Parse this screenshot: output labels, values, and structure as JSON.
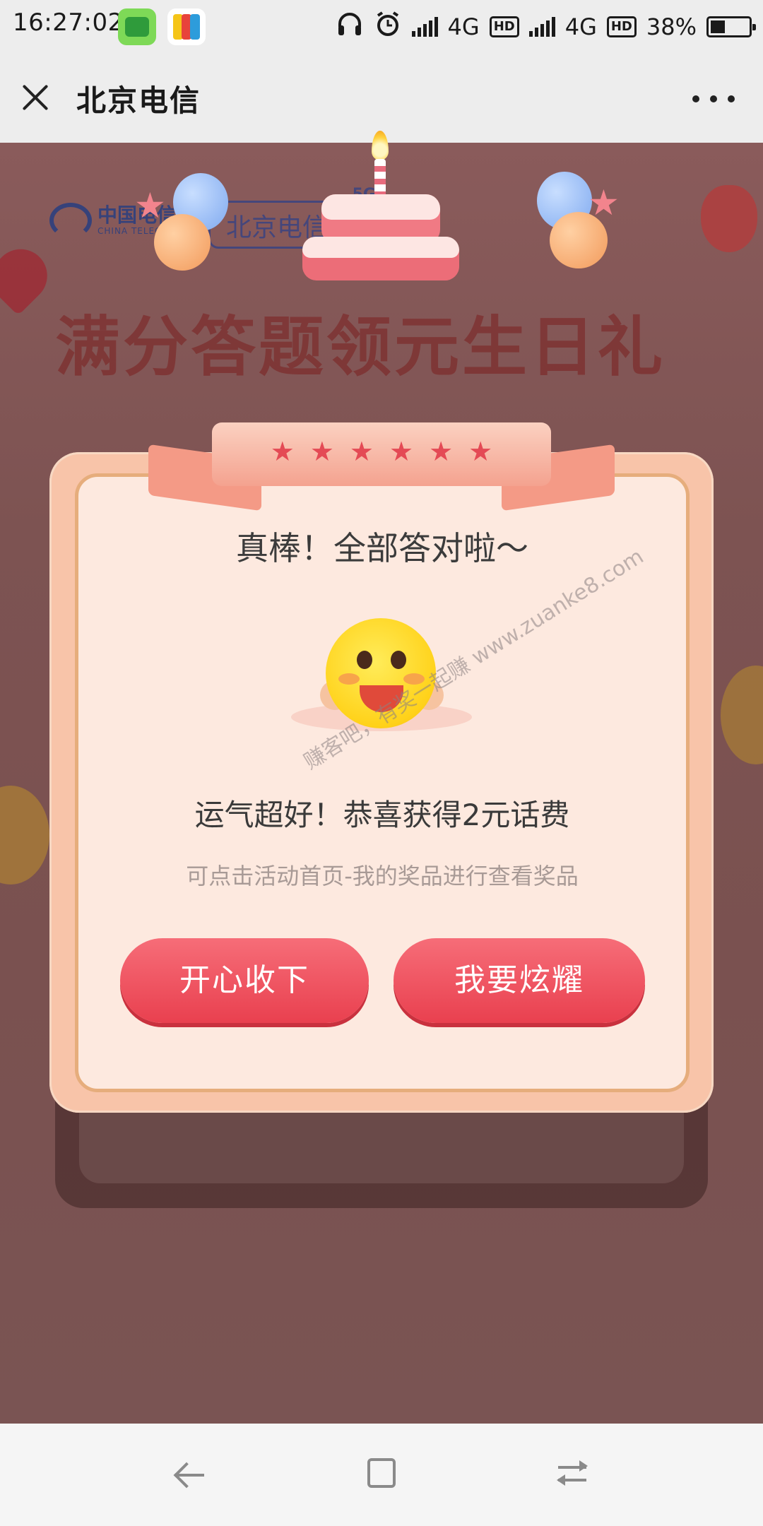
{
  "status_bar": {
    "time": "16:27:02",
    "network_1": "4G",
    "network_2": "4G",
    "hd_label": "HD",
    "battery": "38%",
    "battery_level": 0.38
  },
  "title_bar": {
    "title": "北京电信"
  },
  "background": {
    "brand_logo_text": "中国电信",
    "brand_logo_sub": "CHINA TELECOM",
    "partner_logo_text": "北京电信",
    "partner_logo_badge": "5G",
    "banner_title": "满分答题领元生日礼"
  },
  "modal": {
    "ribbon_stars": [
      "★",
      "★",
      "★",
      "★",
      "★",
      "★"
    ],
    "heading": "真棒！全部答对啦～",
    "prize_text": "运气超好！恭喜获得2元话费",
    "hint_text": "可点击活动首页-我的奖品进行查看奖品",
    "accept_button": "开心收下",
    "share_button": "我要炫耀"
  },
  "watermark": "赚客吧，有奖一起赚 www.zuanke8.com",
  "colors": {
    "button_red": "#ee5260",
    "modal_bg": "#fde9df",
    "modal_border": "#e6ad7c",
    "overlay": "#7d5352"
  },
  "icons": {
    "close": "close-icon",
    "more": "more-icon",
    "back": "back-icon",
    "home": "home-icon",
    "switch": "switch-icon"
  }
}
